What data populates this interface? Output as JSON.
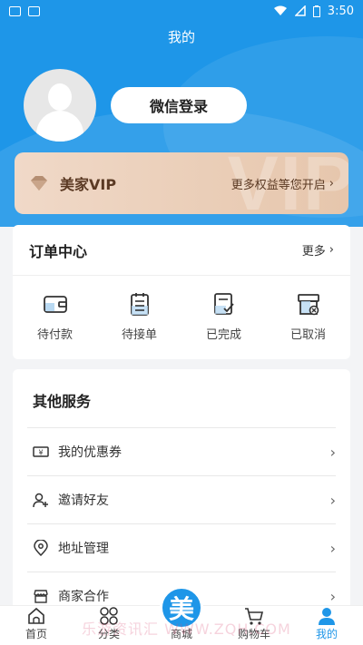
{
  "status_bar": {
    "time": "3:50"
  },
  "header": {
    "title": "我的"
  },
  "profile": {
    "login_label": "微信登录"
  },
  "vip": {
    "label": "美家VIP",
    "link_text": "更多权益等您开启",
    "watermark": "VIP"
  },
  "orders": {
    "title": "订单中心",
    "more_label": "更多",
    "items": [
      {
        "label": "待付款",
        "icon": "wallet-icon"
      },
      {
        "label": "待接单",
        "icon": "clipboard-icon"
      },
      {
        "label": "已完成",
        "icon": "check-document-icon"
      },
      {
        "label": "已取消",
        "icon": "cancel-box-icon"
      }
    ]
  },
  "services": {
    "title": "其他服务",
    "items": [
      {
        "label": "我的优惠券",
        "icon": "coupon-icon"
      },
      {
        "label": "邀请好友",
        "icon": "add-user-icon"
      },
      {
        "label": "地址管理",
        "icon": "location-icon"
      },
      {
        "label": "商家合作",
        "icon": "store-icon"
      }
    ]
  },
  "tabbar": {
    "items": [
      {
        "label": "首页",
        "icon": "home-icon"
      },
      {
        "label": "分类",
        "icon": "category-icon"
      },
      {
        "label": "商城",
        "icon": "mall-logo-icon"
      },
      {
        "label": "购物车",
        "icon": "cart-icon"
      },
      {
        "label": "我的",
        "icon": "profile-icon"
      }
    ],
    "center_logo": "美",
    "active_color": "#1e96e8"
  },
  "watermark": "乐游资讯汇 WWW.ZQH.COM"
}
